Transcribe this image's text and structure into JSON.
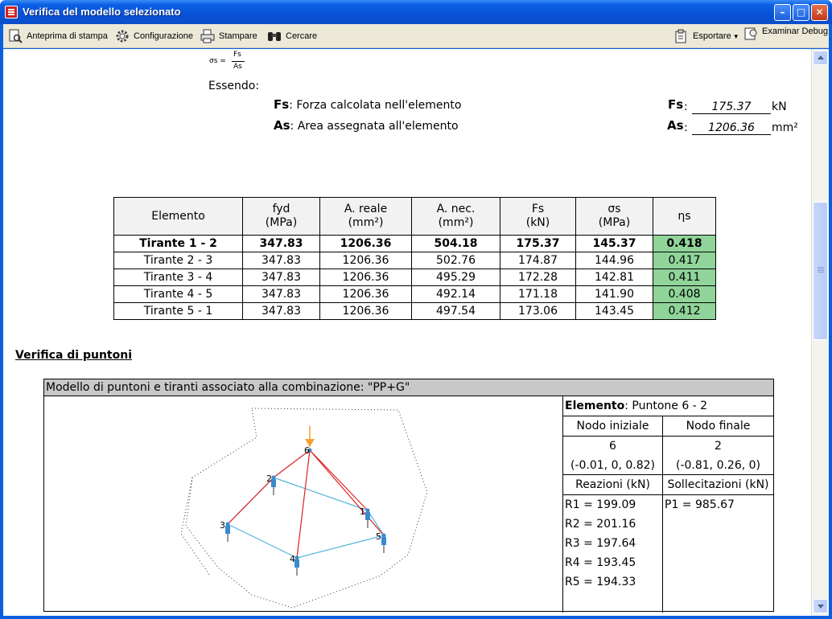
{
  "window": {
    "title": "Verifica del modello selezionato"
  },
  "toolbar": {
    "preview": "Anteprima di stampa",
    "config": "Configurazione",
    "print": "Stampare",
    "search": "Cercare",
    "export": "Esportare",
    "debug": "Examinar Debug"
  },
  "formula": {
    "lhs": "σs =",
    "num": "Fs",
    "den": "As",
    "essendo": "Essendo:",
    "fs_label": "Fs",
    "fs_desc": ": Forza calcolata nell'elemento",
    "as_label": "As",
    "as_desc": ": Area assegnata all'elemento",
    "fs_value": "175.37",
    "fs_unit": "kN",
    "as_value": "1206.36",
    "as_unit": "mm²"
  },
  "table": {
    "headers": [
      [
        "Elemento"
      ],
      [
        "fyd",
        "(MPa)"
      ],
      [
        "A. reale",
        "(mm²)"
      ],
      [
        "A. nec.",
        "(mm²)"
      ],
      [
        "Fs",
        "(kN)"
      ],
      [
        "σs",
        "(MPa)"
      ],
      [
        "ηs"
      ]
    ],
    "rows": [
      [
        "Tirante 1 - 2",
        "347.83",
        "1206.36",
        "504.18",
        "175.37",
        "145.37",
        "0.418"
      ],
      [
        "Tirante 2 - 3",
        "347.83",
        "1206.36",
        "502.76",
        "174.87",
        "144.96",
        "0.417"
      ],
      [
        "Tirante 3 - 4",
        "347.83",
        "1206.36",
        "495.29",
        "172.28",
        "142.81",
        "0.411"
      ],
      [
        "Tirante 4 - 5",
        "347.83",
        "1206.36",
        "492.14",
        "171.18",
        "141.90",
        "0.408"
      ],
      [
        "Tirante 5 - 1",
        "347.83",
        "1206.36",
        "497.54",
        "173.06",
        "143.45",
        "0.412"
      ]
    ]
  },
  "puntoni": {
    "section_title": "Verifica di puntoni",
    "model_header": "Modello di puntoni e tiranti associato alla combinazione: \"PP+G\"",
    "element_label": "Elemento",
    "element_value": ": Puntone 6 - 2",
    "nodo_iniziale": "Nodo iniziale",
    "nodo_finale": "Nodo finale",
    "nodo_i_id": "6",
    "nodo_f_id": "2",
    "nodo_i_coords": "(-0.01, 0, 0.82)",
    "nodo_f_coords": "(-0.81, 0.26, 0)",
    "reazioni": "Reazioni (kN)",
    "sollecitazioni": "Sollecitazioni (kN)",
    "reactions": [
      "R1 = 199.09",
      "R2 = 201.16",
      "R3 = 197.64",
      "R4 = 193.45",
      "R5 = 194.33"
    ],
    "loads": [
      "P1 = 985.67"
    ],
    "nodes": [
      "1",
      "2",
      "3",
      "4",
      "5",
      "6"
    ]
  },
  "colors": {
    "eta_ok": "#90d49a",
    "tie": "#55b4dc",
    "strut": "#e02020",
    "load": "#f5a030"
  }
}
